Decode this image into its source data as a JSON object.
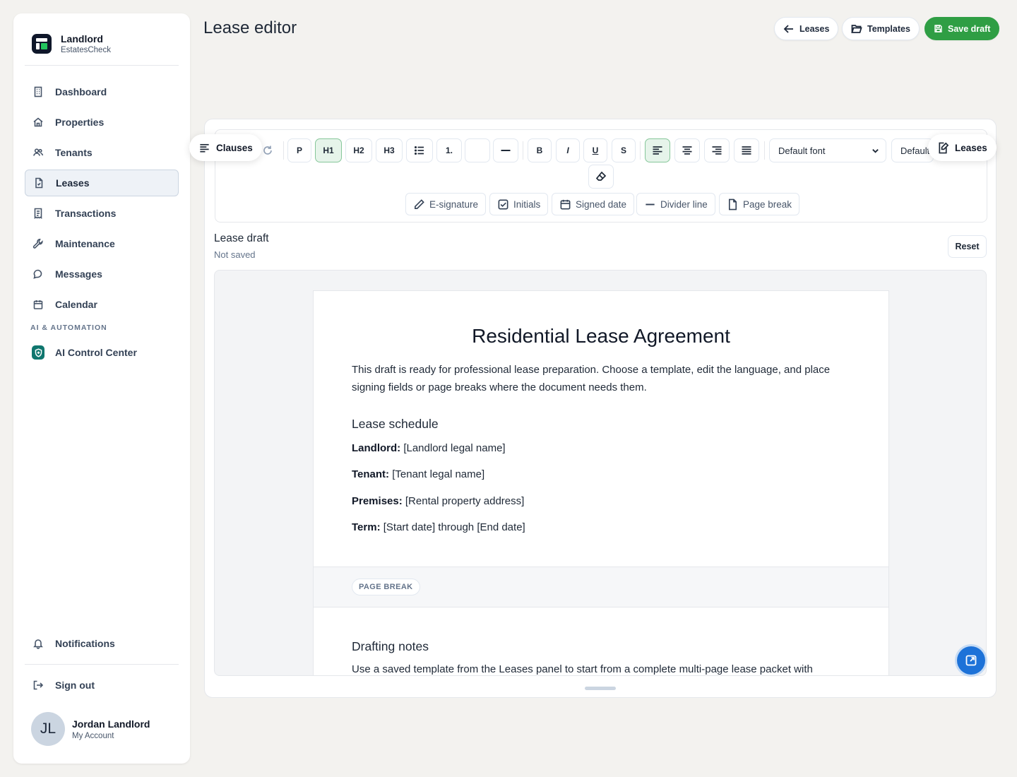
{
  "brand": {
    "title": "Landlord",
    "subtitle": "EstatesCheck"
  },
  "nav": {
    "items": [
      {
        "label": "Dashboard",
        "icon": "building-icon"
      },
      {
        "label": "Properties",
        "icon": "home-icon"
      },
      {
        "label": "Tenants",
        "icon": "users-icon"
      },
      {
        "label": "Leases",
        "icon": "file-icon",
        "active": true
      },
      {
        "label": "Transactions",
        "icon": "receipt-icon"
      },
      {
        "label": "Maintenance",
        "icon": "wrench-icon"
      },
      {
        "label": "Messages",
        "icon": "message-icon"
      },
      {
        "label": "Calendar",
        "icon": "calendar-icon"
      }
    ],
    "section_label": "AI & AUTOMATION",
    "ai_item": "AI Control Center",
    "notifications": "Notifications",
    "sign_out": "Sign out"
  },
  "user": {
    "initials": "JL",
    "name": "Jordan Landlord",
    "sub": "My Account"
  },
  "header": {
    "title": "Lease editor",
    "leases_button": "Leases",
    "templates_button": "Templates",
    "save_button": "Save draft"
  },
  "toolbar": {
    "clauses_label": "Clauses",
    "leases_label": "Leases",
    "p": "P",
    "h1": "H1",
    "h2": "H2",
    "h3": "H3",
    "ordered": "1.",
    "bold": "B",
    "italic": "I",
    "underline": "U",
    "strike": "S",
    "font_select": "Default font",
    "size_select": "Default",
    "chips": [
      "E-signature",
      "Initials",
      "Signed date",
      "Divider line",
      "Page break"
    ]
  },
  "draft": {
    "title": "Lease draft",
    "status": "Not saved",
    "reset": "Reset"
  },
  "document": {
    "heading": "Residential Lease Agreement",
    "intro": "This draft is ready for professional lease preparation. Choose a template, edit the language, and place signing fields or page breaks where the document needs them.",
    "schedule_heading": "Lease schedule",
    "landlord_label": "Landlord:",
    "landlord_value": "[Landlord legal name]",
    "tenant_label": "Tenant:",
    "tenant_value": "[Tenant legal name]",
    "premises_label": "Premises:",
    "premises_value": "[Rental property address]",
    "term_label": "Term:",
    "term_value": "[Start date] through [End date]",
    "page_break_tag": "PAGE BREAK",
    "notes_heading": "Drafting notes",
    "notes_text": "Use a saved template from the Leases panel to start from a complete multi-page lease packet with"
  },
  "colors": {
    "accent_green": "#2f9e44",
    "fab_blue": "#1d72d8",
    "ai_teal": "#0f766e"
  }
}
